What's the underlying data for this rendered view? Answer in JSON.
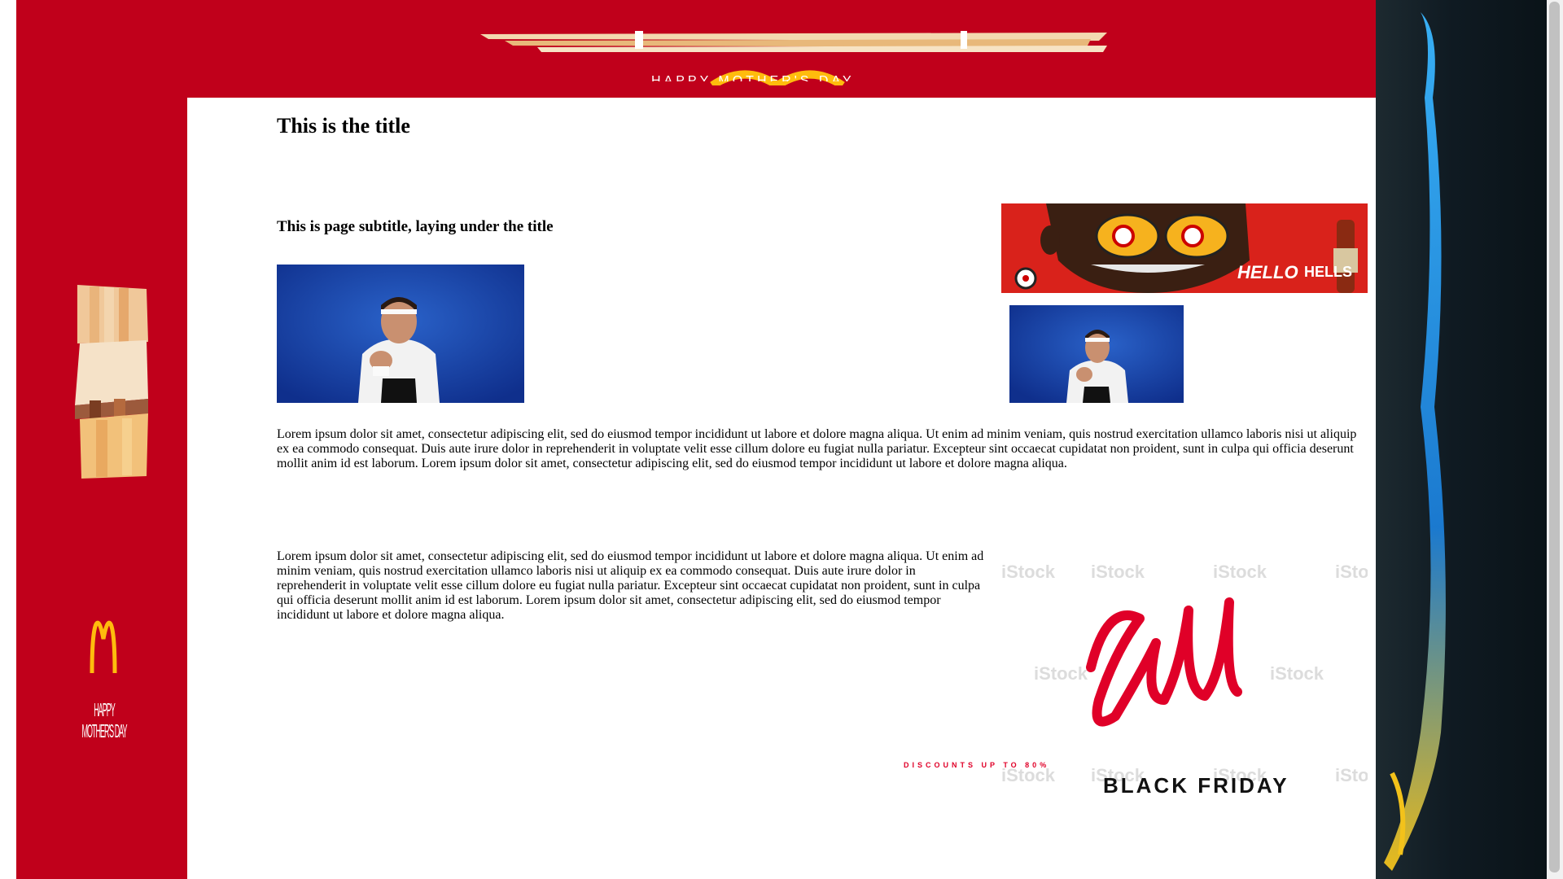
{
  "page": {
    "title": "This is the title",
    "subtitle": "This is page subtitle, laying under the title",
    "paragraph_1": "Lorem ipsum dolor sit amet, consectetur adipiscing elit, sed do eiusmod tempor incididunt ut labore et dolore magna aliqua. Ut enim ad minim veniam, quis nostrud exercitation ullamco laboris nisi ut aliquip ex ea commodo consequat. Duis aute irure dolor in reprehenderit in voluptate velit esse cillum dolore eu fugiat nulla pariatur. Excepteur sint occaecat cupidatat non proident, sunt in culpa qui officia deserunt mollit anim id est laborum. Lorem ipsum dolor sit amet, consectetur adipiscing elit, sed do eiusmod tempor incididunt ut labore et dolore magna aliqua.",
    "paragraph_2": "Lorem ipsum dolor sit amet, consectetur adipiscing elit, sed do eiusmod tempor incididunt ut labore et dolore magna aliqua. Ut enim ad minim veniam, quis nostrud exercitation ullamco laboris nisi ut aliquip ex ea commodo consequat. Duis aute irure dolor in reprehenderit in voluptate velit esse cillum dolore eu fugiat nulla pariatur. Excepteur sint occaecat cupidatat non proident, sunt in culpa qui officia deserunt mollit anim id est laborum. Lorem ipsum dolor sit amet, consectetur adipiscing elit, sed do eiusmod tempor incididunt ut labore et dolore magna aliqua."
  },
  "ads": {
    "top_banner_text": "HAPPY MOTHER'S DAY",
    "left_banner_text": "HAPPY MOTHER'S DAY",
    "beer_ad_text": "HELLO",
    "beer_ad_brand": "HELLS",
    "sale_title": "Sale",
    "sale_subtitle": "BLACK FRIDAY",
    "sale_caption": "DISCOUNTS UP TO 80%",
    "watermark": "iStock"
  },
  "colors": {
    "banner_red": "#c0001b",
    "mcd_yellow": "#ffbc0d",
    "sale_red": "#e00028"
  },
  "icons": {
    "left_logo": "golden-arches-icon"
  }
}
